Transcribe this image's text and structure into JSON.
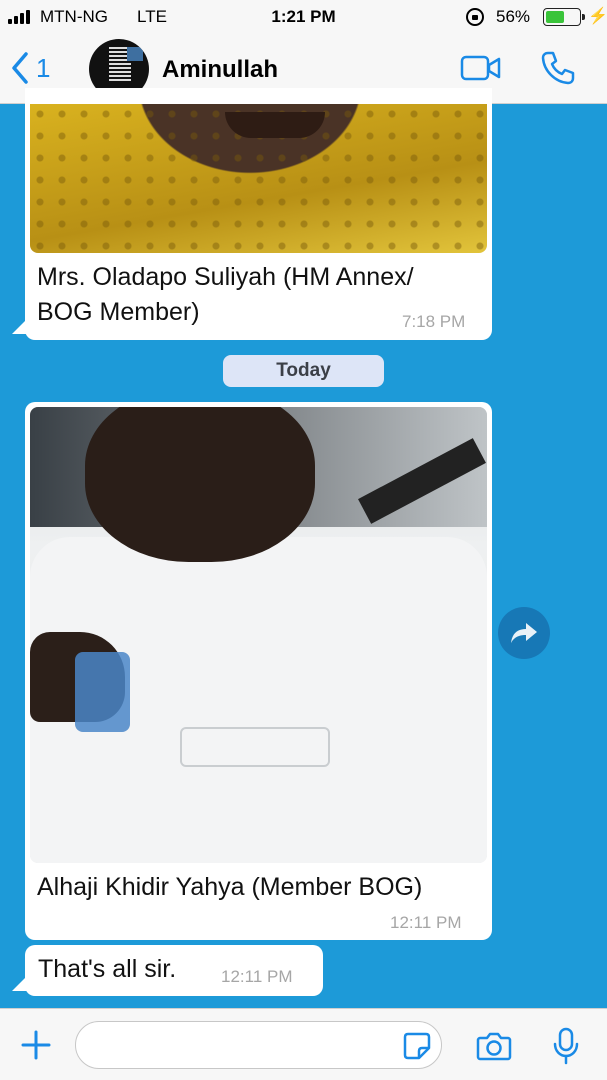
{
  "status_bar": {
    "carrier": "MTN-NG",
    "network": "LTE",
    "time": "1:21 PM",
    "battery": "56%",
    "battery_level": 0.56
  },
  "header": {
    "back_count": "1",
    "contact_name": "Aminullah"
  },
  "messages": [
    {
      "type": "image",
      "caption_line1": "Mrs. Oladapo Suliyah (HM Annex/",
      "caption_line2": "BOG Member)",
      "time": "7:18 PM"
    },
    {
      "type": "image",
      "caption": "Alhaji Khidir Yahya (Member BOG)",
      "time": "12:11 PM"
    },
    {
      "type": "text",
      "text": "That's all sir.",
      "time": "12:11 PM"
    }
  ],
  "date_separator": "Today",
  "icons": {
    "back": "chevron-left-icon",
    "video": "video-camera-icon",
    "call": "phone-icon",
    "forward": "forward-arrow-icon",
    "plus": "plus-icon",
    "sticker": "sticker-icon",
    "camera": "camera-icon",
    "mic": "microphone-icon"
  },
  "colors": {
    "chat_background": "#1d9ad8",
    "accent": "#1a8ae6",
    "date_chip": "#dde5f7"
  },
  "input": {
    "value": "",
    "placeholder": ""
  }
}
